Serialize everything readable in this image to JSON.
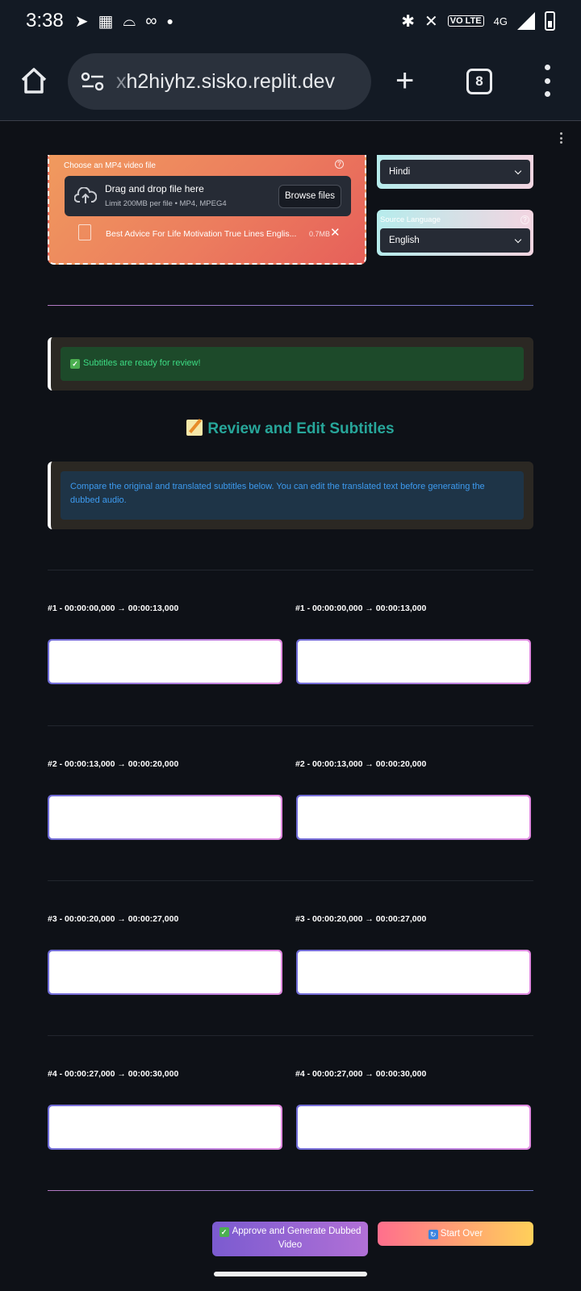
{
  "status_bar": {
    "time": "3:38",
    "network_type": "4G",
    "volte_label": "VO LTE"
  },
  "browser": {
    "url_prefix": "x",
    "url": "h2hiyhz.sisko.replit.dev",
    "tab_count": "8"
  },
  "upload": {
    "label": "Choose an MP4 video file",
    "drop_title": "Drag and drop file here",
    "limit_text": "Limit 200MB per file • MP4, MPEG4",
    "browse_label": "Browse files",
    "file_name": "Best Advice For Life Motivation True Lines Englis...",
    "file_size": "0.7MB"
  },
  "languages": {
    "target_value": "Hindi",
    "source_label": "Source Language",
    "source_value": "English"
  },
  "success_alert": "Subtitles are ready for review!",
  "section_title": "Review and Edit Subtitles",
  "info_alert": "Compare the original and translated subtitles below. You can edit the translated text before generating the dubbed audio.",
  "subtitles": [
    {
      "timestamp": "#1 - 00:00:00,000 → 00:00:13,000",
      "original": "",
      "translated": ""
    },
    {
      "timestamp": "#2 - 00:00:13,000 → 00:00:20,000",
      "original": "",
      "translated": ""
    },
    {
      "timestamp": "#3 - 00:00:20,000 → 00:00:27,000",
      "original": "",
      "translated": ""
    },
    {
      "timestamp": "#4 - 00:00:27,000 → 00:00:30,000",
      "original": "",
      "translated": ""
    }
  ],
  "buttons": {
    "approve_label": "Approve and Generate Dubbed Video",
    "start_over_label": "Start Over"
  },
  "colors": {
    "page_bg": "#0e1117",
    "title_teal": "#27a69a",
    "success_text": "#3ddc84",
    "info_text": "#3d9bf0"
  }
}
